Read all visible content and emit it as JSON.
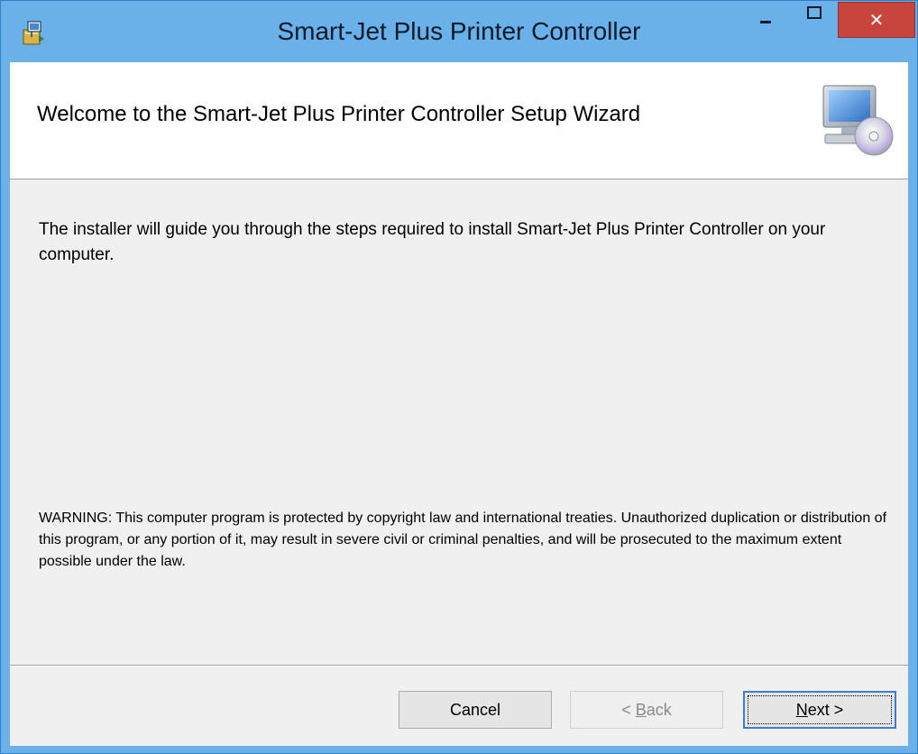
{
  "window": {
    "title_bold": "Smart-Jet Plus",
    "title_rest": " Printer Controller",
    "minimize_icon": "minimize-icon",
    "maximize_icon": "maximize-icon",
    "close_icon": "close-icon",
    "close_glyph": "✕",
    "app_icon": "installer-icon"
  },
  "header": {
    "title": "Welcome to the Smart-Jet Plus Printer Controller Setup Wizard",
    "image_icon": "computer-cd-icon"
  },
  "body": {
    "intro": "The installer will guide you through the steps required  to install Smart-Jet Plus Printer Controller on your computer.",
    "warning": "WARNING: This computer program is protected by copyright law and international treaties. Unauthorized duplication or distribution of this program, or any portion of it, may result in severe civil or criminal penalties, and will be prosecuted to the maximum extent possible under the law."
  },
  "buttons": {
    "cancel": "Cancel",
    "back_prefix": "< ",
    "back_mnemonic": "B",
    "back_rest": "ack",
    "next_mnemonic": "N",
    "next_rest": "ext >"
  },
  "colors": {
    "titlebar": "#6ab1ea",
    "close_button": "#c7453c",
    "dialog_background": "#f0f0f0",
    "focus_border": "#3c7fd1"
  }
}
